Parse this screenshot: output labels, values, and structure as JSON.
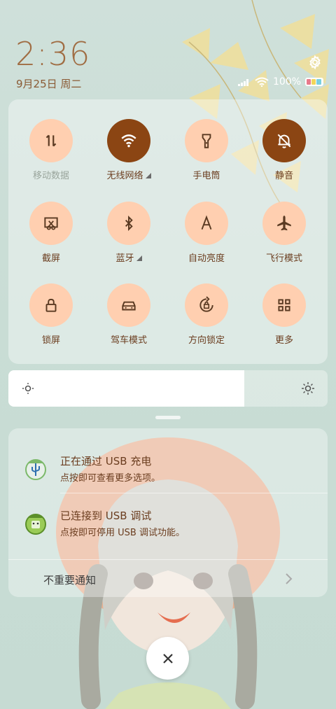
{
  "header": {
    "time": "2:36",
    "date": "9月25日 周二",
    "battery_percent": "100%",
    "settings_icon": "gear-icon"
  },
  "quick_settings": [
    {
      "label": "移动数据",
      "icon": "data-arrows-icon",
      "active": false,
      "dimmed": true,
      "has_menu": false
    },
    {
      "label": "无线网络",
      "icon": "wifi-icon",
      "active": true,
      "dimmed": false,
      "has_menu": true
    },
    {
      "label": "手电筒",
      "icon": "flashlight-icon",
      "active": false,
      "dimmed": false,
      "has_menu": false
    },
    {
      "label": "静音",
      "icon": "bell-off-icon",
      "active": true,
      "dimmed": false,
      "has_menu": false
    },
    {
      "label": "截屏",
      "icon": "screenshot-scissors-icon",
      "active": false,
      "dimmed": false,
      "has_menu": false
    },
    {
      "label": "蓝牙",
      "icon": "bluetooth-icon",
      "active": false,
      "dimmed": false,
      "has_menu": true
    },
    {
      "label": "自动亮度",
      "icon": "auto-brightness-icon",
      "active": false,
      "dimmed": false,
      "has_menu": false
    },
    {
      "label": "飞行模式",
      "icon": "airplane-icon",
      "active": false,
      "dimmed": false,
      "has_menu": false
    },
    {
      "label": "锁屏",
      "icon": "lock-icon",
      "active": false,
      "dimmed": false,
      "has_menu": false
    },
    {
      "label": "驾车模式",
      "icon": "car-icon",
      "active": false,
      "dimmed": false,
      "has_menu": false
    },
    {
      "label": "方向锁定",
      "icon": "rotation-lock-icon",
      "active": false,
      "dimmed": false,
      "has_menu": false
    },
    {
      "label": "更多",
      "icon": "grid-icon",
      "active": false,
      "dimmed": false,
      "has_menu": false
    }
  ],
  "brightness": {
    "level_percent": 74
  },
  "notifications": [
    {
      "title": "正在通过  USB  充电",
      "subtitle": "点按即可查看更多选项。",
      "icon": "usb-charging-app-icon"
    },
    {
      "title": "已连接到  USB  调试",
      "subtitle": "点按即可停用 USB 调试功能。",
      "icon": "usb-debug-app-icon"
    }
  ],
  "unimportant_label": "不重要通知",
  "colors": {
    "active": "#8b4513",
    "tile": "#ffcfb0",
    "text": "#6b3d1f"
  }
}
